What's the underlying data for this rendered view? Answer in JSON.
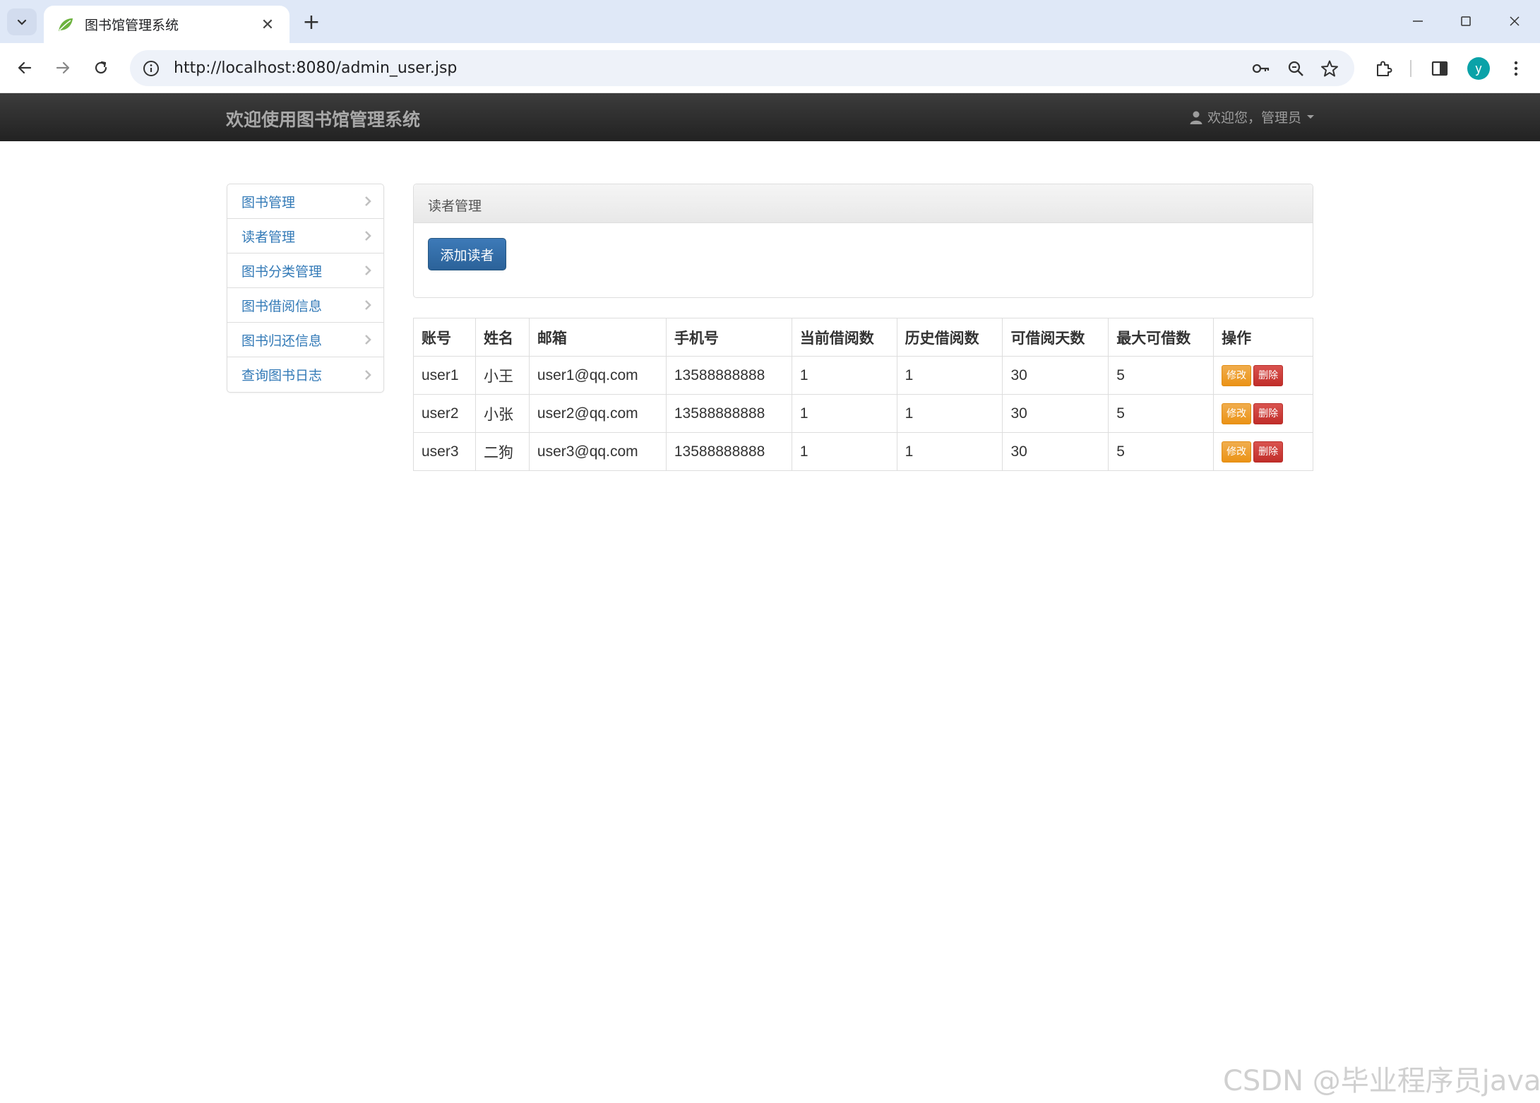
{
  "browser": {
    "tab_title": "图书馆管理系统",
    "tab_close": "✕",
    "new_tab": "+",
    "url": "http://localhost:8080/admin_user.jsp",
    "avatar_letter": "y"
  },
  "navbar": {
    "brand": "欢迎使用图书馆管理系统",
    "user_menu": "欢迎您，管理员"
  },
  "sidebar": {
    "items": [
      {
        "label": "图书管理"
      },
      {
        "label": "读者管理"
      },
      {
        "label": "图书分类管理"
      },
      {
        "label": "图书借阅信息"
      },
      {
        "label": "图书归还信息"
      },
      {
        "label": "查询图书日志"
      }
    ]
  },
  "panel": {
    "title": "读者管理",
    "add_button": "添加读者"
  },
  "table": {
    "headers": [
      "账号",
      "姓名",
      "邮箱",
      "手机号",
      "当前借阅数",
      "历史借阅数",
      "可借阅天数",
      "最大可借数",
      "操作"
    ],
    "rows": [
      {
        "account": "user1",
        "name": "小王",
        "email": "user1@qq.com",
        "phone": "13588888888",
        "current": "1",
        "history": "1",
        "days": "30",
        "max": "5"
      },
      {
        "account": "user2",
        "name": "小张",
        "email": "user2@qq.com",
        "phone": "13588888888",
        "current": "1",
        "history": "1",
        "days": "30",
        "max": "5"
      },
      {
        "account": "user3",
        "name": "二狗",
        "email": "user3@qq.com",
        "phone": "13588888888",
        "current": "1",
        "history": "1",
        "days": "30",
        "max": "5"
      }
    ],
    "edit_label": "修改",
    "delete_label": "删除"
  },
  "watermark": "CSDN @毕业程序员java",
  "colors": {
    "navbar": "#222222",
    "link": "#337ab7",
    "primary": "#2b6299",
    "warning": "#eb9316",
    "danger": "#c12e2a"
  },
  "icons": {
    "tab_menu": "chevron-down-icon",
    "favicon": "leaf-icon",
    "back": "back-arrow-icon",
    "forward": "forward-arrow-icon",
    "reload": "reload-icon",
    "site_info": "info-icon",
    "password": "key-icon",
    "zoom": "zoom-icon",
    "bookmark": "star-icon",
    "extensions": "puzzle-icon",
    "side_panel": "side-panel-icon",
    "menu": "kebab-menu-icon",
    "user": "user-icon",
    "sidebar_chevron": "chevron-right-icon"
  }
}
